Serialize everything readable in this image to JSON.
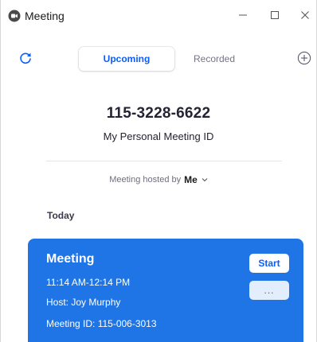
{
  "window": {
    "title": "Meeting",
    "controls": [
      "minimize-icon",
      "maximize-icon",
      "close-icon"
    ]
  },
  "toolbar": {
    "refresh_icon": "refresh-icon",
    "tabs": [
      {
        "label": "Upcoming",
        "active": true
      },
      {
        "label": "Recorded",
        "active": false
      }
    ],
    "add_icon": "add-circle-icon"
  },
  "personal_meeting": {
    "id": "115-3228-6622",
    "label": "My Personal Meeting ID"
  },
  "hosted_by": {
    "prefix": "Meeting hosted by",
    "value": "Me"
  },
  "section": {
    "title": "Today"
  },
  "meeting_card": {
    "title": "Meeting",
    "time": "11:14 AM-12:14 PM",
    "host": "Host: Joy Murphy",
    "meeting_id": "Meeting ID: 115-006-3013",
    "start_label": "Start",
    "more_label": "..."
  },
  "colors": {
    "accent": "#0b5cff",
    "card": "#1f74e6"
  }
}
